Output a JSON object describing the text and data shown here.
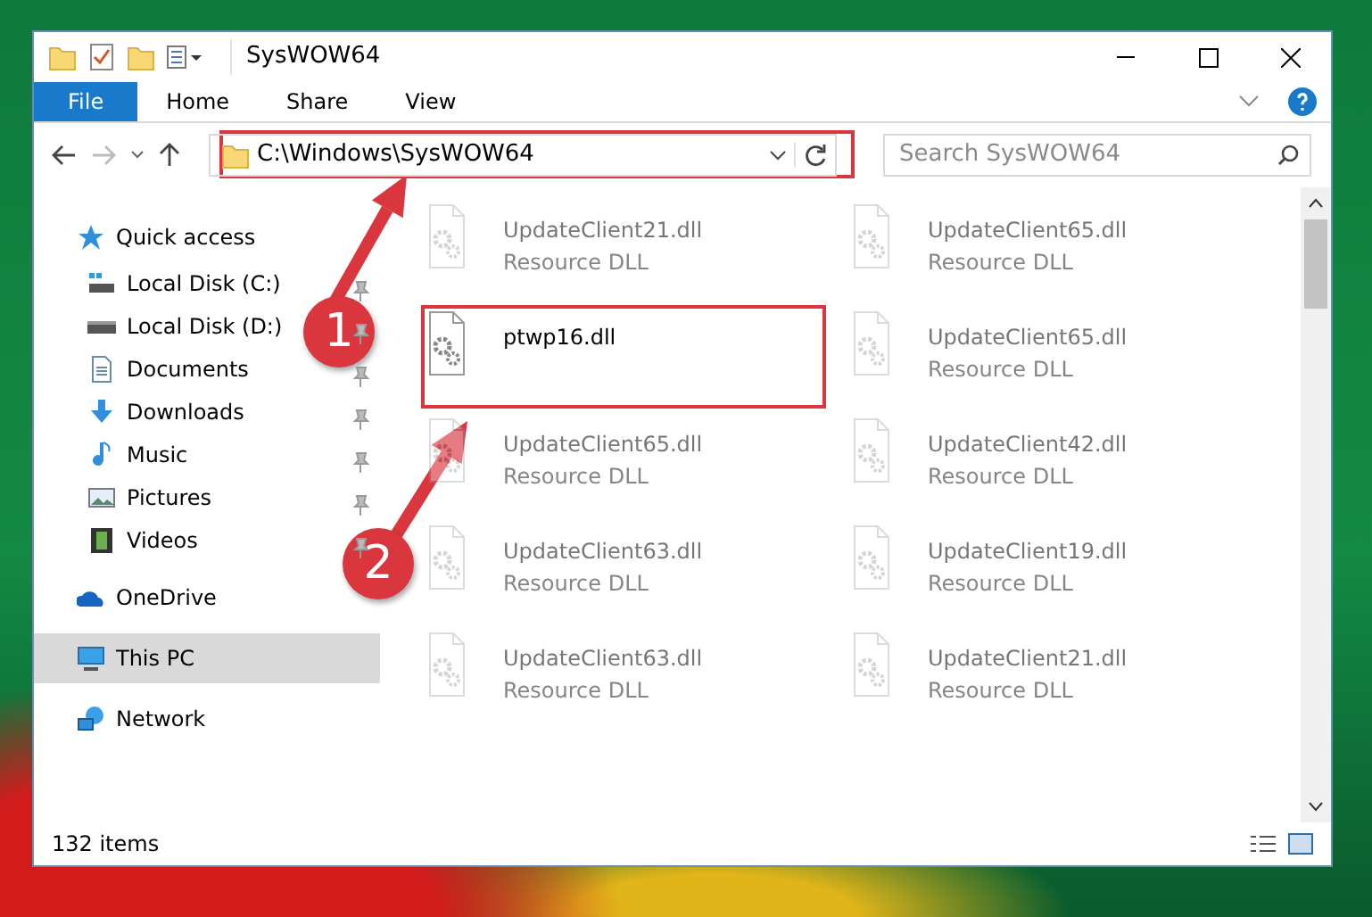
{
  "window": {
    "title": "SysWOW64"
  },
  "ribbon_tabs": [
    {
      "label": "File",
      "kind": "file"
    },
    {
      "label": "Home",
      "kind": "tab"
    },
    {
      "label": "Share",
      "kind": "tab"
    },
    {
      "label": "View",
      "kind": "tab"
    }
  ],
  "address_bar": {
    "path": "C:\\Windows\\SysWOW64"
  },
  "search": {
    "placeholder": "Search SysWOW64"
  },
  "navigation": [
    {
      "label": "Quick access",
      "kind": "star",
      "selected": false,
      "children": [
        {
          "label": "Local Disk (C:)",
          "kind": "drive-c",
          "pinned": true
        },
        {
          "label": "Local Disk (D:)",
          "kind": "drive",
          "pinned": true
        },
        {
          "label": "Documents",
          "kind": "documents",
          "pinned": true
        },
        {
          "label": "Downloads",
          "kind": "downloads",
          "pinned": true
        },
        {
          "label": "Music",
          "kind": "music",
          "pinned": true
        },
        {
          "label": "Pictures",
          "kind": "pictures",
          "pinned": true
        },
        {
          "label": "Videos",
          "kind": "videos",
          "pinned": true
        }
      ]
    },
    {
      "label": "OneDrive",
      "kind": "cloud",
      "selected": false
    },
    {
      "label": "This PC",
      "kind": "pc",
      "selected": true
    },
    {
      "label": "Network",
      "kind": "network",
      "selected": false
    }
  ],
  "files": [
    {
      "name": "UpdateClient21.dll",
      "type": "Resource DLL",
      "faded": true
    },
    {
      "name": "UpdateClient65.dll",
      "type": "Resource DLL",
      "faded": true
    },
    {
      "name": "ptwp16.dll",
      "faded": false
    },
    {
      "name": "UpdateClient65.dll",
      "type": "Resource DLL",
      "faded": true
    },
    {
      "name": "UpdateClient65.dll",
      "type": "Resource DLL",
      "faded": true
    },
    {
      "name": "UpdateClient42.dll",
      "type": "Resource DLL",
      "faded": true
    },
    {
      "name": "UpdateClient63.dll",
      "type": "Resource DLL",
      "faded": true
    },
    {
      "name": "UpdateClient19.dll",
      "type": "Resource DLL",
      "faded": true
    },
    {
      "name": "UpdateClient63.dll",
      "type": "Resource DLL",
      "faded": true
    },
    {
      "name": "UpdateClient21.dll",
      "type": "Resource DLL",
      "faded": true
    }
  ],
  "status_bar": {
    "item_count": "132 items"
  },
  "annotations": [
    {
      "number": "1"
    },
    {
      "number": "2"
    }
  ]
}
